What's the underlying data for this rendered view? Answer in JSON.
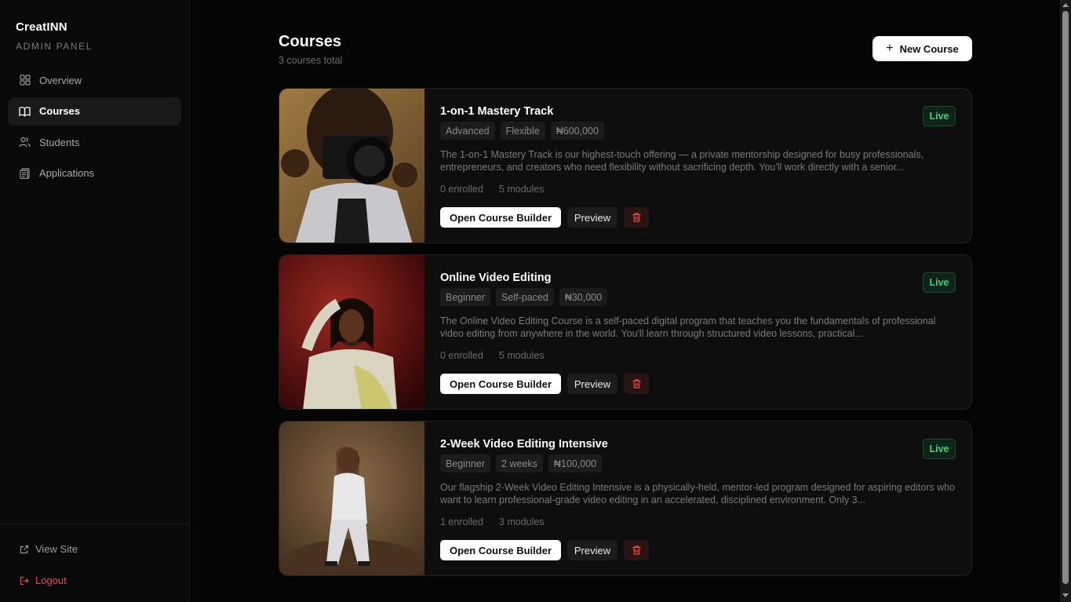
{
  "brand": {
    "name": "CreatINN",
    "subtitle": "ADMIN PANEL"
  },
  "nav": [
    {
      "label": "Overview",
      "icon": "grid-icon",
      "active": false
    },
    {
      "label": "Courses",
      "icon": "book-icon",
      "active": true
    },
    {
      "label": "Students",
      "icon": "users-icon",
      "active": false
    },
    {
      "label": "Applications",
      "icon": "clipboard-icon",
      "active": false
    }
  ],
  "sidebar_bottom": {
    "view_site": "View Site",
    "logout": "Logout"
  },
  "header": {
    "title": "Courses",
    "subtitle": "3 courses total",
    "new_course": "New Course"
  },
  "courses": [
    {
      "title": "1-on-1 Mastery Track",
      "tags": [
        "Advanced",
        "Flexible",
        "₦600,000"
      ],
      "description": "The 1-on-1 Mastery Track is our highest-touch offering — a private mentorship designed for busy professionals, entrepreneurs, and creators who need flexibility without sacrificing depth. You'll work directly with a senior...",
      "enrolled": "0 enrolled",
      "modules": "5 modules",
      "status": "Live",
      "builder": "Open Course Builder",
      "preview": "Preview"
    },
    {
      "title": "Online Video Editing",
      "tags": [
        "Beginner",
        "Self-paced",
        "₦30,000"
      ],
      "description": "The Online Video Editing Course is a self-paced digital program that teaches you the fundamentals of professional video editing from anywhere in the world. You'll learn through structured video lessons, practical...",
      "enrolled": "0 enrolled",
      "modules": "5 modules",
      "status": "Live",
      "builder": "Open Course Builder",
      "preview": "Preview"
    },
    {
      "title": "2-Week Video Editing Intensive",
      "tags": [
        "Beginner",
        "2 weeks",
        "₦100,000"
      ],
      "description": "Our flagship 2-Week Video Editing Intensive is a physically-held, mentor-led program designed for aspiring editors who want to learn professional-grade video editing in an accelerated, disciplined environment. Only 3...",
      "enrolled": "1 enrolled",
      "modules": "3 modules",
      "status": "Live",
      "builder": "Open Course Builder",
      "preview": "Preview"
    }
  ],
  "colors": {
    "accent_live": "#3ed27a",
    "danger": "#d9534f",
    "background": "#050505"
  }
}
